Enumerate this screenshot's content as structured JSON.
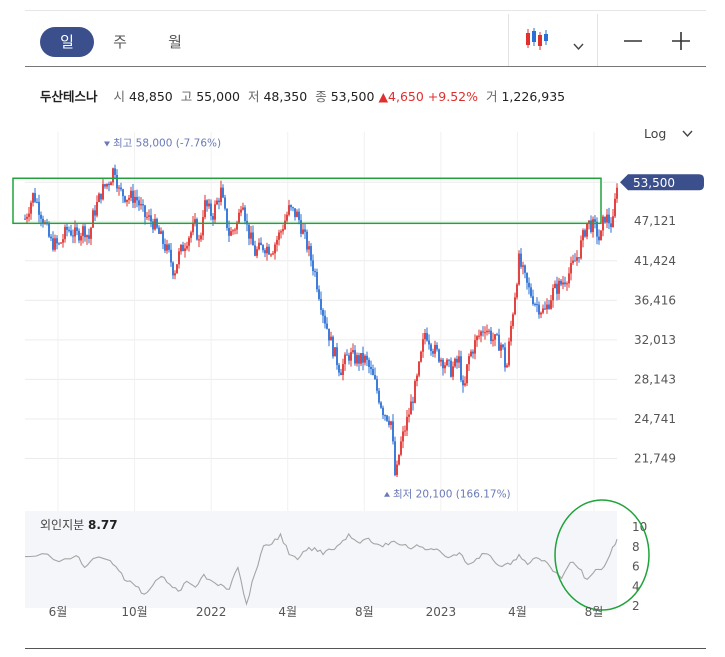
{
  "tabs": [
    {
      "label": "일",
      "active": true
    },
    {
      "label": "주",
      "active": false
    },
    {
      "label": "월",
      "active": false
    }
  ],
  "toolbar": {
    "chart_type_icon": "candlestick-icon",
    "zoom_out": "−",
    "zoom_in": "+"
  },
  "quote": {
    "name": "두산테스나",
    "open_label": "시",
    "open": "48,850",
    "high_label": "고",
    "high": "55,000",
    "low_label": "저",
    "low": "48,350",
    "close_label": "종",
    "close": "53,500",
    "change": "▲4,650 +9.52%",
    "volume_label": "거",
    "volume": "1,226,935"
  },
  "scale_toggle": "Log",
  "colors": {
    "up": "#e0302e",
    "down": "#2a6fd6",
    "accent": "#3a4f8c",
    "highlight": "#1fa33a",
    "indicator": "#a5a5a5"
  },
  "chart_data": {
    "type": "candlestick",
    "scale": "log",
    "ylim": [
      19500,
      61000
    ],
    "yticks": [
      "53,500",
      "47,121",
      "41,424",
      "36,416",
      "32,013",
      "28,143",
      "24,741",
      "21,749"
    ],
    "xticks": [
      "6월",
      "10월",
      "2022",
      "4월",
      "8월",
      "2023",
      "4월",
      "8월"
    ],
    "last_price": "53,500",
    "high_annotation": "최고 58,000 (-7.76%)",
    "low_annotation": "최저 20,100 (166.17%)",
    "series_path": [
      [
        0,
        47500
      ],
      [
        2,
        51500
      ],
      [
        4,
        48000
      ],
      [
        6,
        44000
      ],
      [
        8,
        43500
      ],
      [
        10,
        46000
      ],
      [
        12,
        45000
      ],
      [
        14,
        46000
      ],
      [
        15,
        44500
      ],
      [
        16,
        48000
      ],
      [
        18,
        52000
      ],
      [
        20,
        54000
      ],
      [
        21,
        56500
      ],
      [
        22,
        52000
      ],
      [
        24,
        51000
      ],
      [
        26,
        51000
      ],
      [
        28,
        48000
      ],
      [
        30,
        47000
      ],
      [
        32,
        44500
      ],
      [
        34,
        42000
      ],
      [
        35,
        39800
      ],
      [
        36,
        42000
      ],
      [
        38,
        44500
      ],
      [
        40,
        46500
      ],
      [
        41,
        43500
      ],
      [
        42,
        50000
      ],
      [
        44,
        48000
      ],
      [
        46,
        52000
      ],
      [
        47,
        48000
      ],
      [
        48,
        45000
      ],
      [
        50,
        47000
      ],
      [
        51,
        51500
      ],
      [
        52,
        46500
      ],
      [
        54,
        42500
      ],
      [
        56,
        43500
      ],
      [
        58,
        43000
      ],
      [
        60,
        45500
      ],
      [
        62,
        49000
      ],
      [
        64,
        48000
      ],
      [
        66,
        44000
      ],
      [
        68,
        40000
      ],
      [
        70,
        35000
      ],
      [
        72,
        31500
      ],
      [
        74,
        29000
      ],
      [
        76,
        30500
      ],
      [
        78,
        30000
      ],
      [
        80,
        30000
      ],
      [
        82,
        28000
      ],
      [
        84,
        25500
      ],
      [
        86,
        24500
      ],
      [
        87,
        20100
      ],
      [
        88,
        22500
      ],
      [
        90,
        25000
      ],
      [
        92,
        28000
      ],
      [
        94,
        33000
      ],
      [
        96,
        31000
      ],
      [
        98,
        30000
      ],
      [
        100,
        29000
      ],
      [
        102,
        30000
      ],
      [
        103,
        26500
      ],
      [
        104,
        30000
      ],
      [
        106,
        32000
      ],
      [
        108,
        33500
      ],
      [
        110,
        32000
      ],
      [
        112,
        31500
      ],
      [
        113,
        28800
      ],
      [
        114,
        33000
      ],
      [
        116,
        41500
      ],
      [
        118,
        38000
      ],
      [
        120,
        36000
      ],
      [
        122,
        35000
      ],
      [
        124,
        37500
      ],
      [
        126,
        38500
      ],
      [
        128,
        40000
      ],
      [
        130,
        42500
      ],
      [
        132,
        47000
      ],
      [
        134,
        46000
      ],
      [
        135,
        44000
      ],
      [
        136,
        48000
      ],
      [
        138,
        46500
      ],
      [
        139,
        53500
      ]
    ],
    "highlight_box": {
      "from_price": 46800,
      "to_price": 54200
    }
  },
  "indicator": {
    "label": "외인지분",
    "value": "8.77",
    "yticks": [
      "10",
      "8",
      "6",
      "4",
      "2"
    ],
    "ylim": [
      2,
      10
    ],
    "series_path": [
      [
        0,
        7.0
      ],
      [
        4,
        7.3
      ],
      [
        8,
        6.5
      ],
      [
        12,
        7.1
      ],
      [
        14,
        5.9
      ],
      [
        16,
        6.8
      ],
      [
        20,
        6.6
      ],
      [
        22,
        5.6
      ],
      [
        24,
        4.5
      ],
      [
        26,
        4.0
      ],
      [
        28,
        3.2
      ],
      [
        30,
        4.1
      ],
      [
        32,
        5.0
      ],
      [
        34,
        4.2
      ],
      [
        36,
        3.5
      ],
      [
        38,
        4.5
      ],
      [
        40,
        3.9
      ],
      [
        42,
        5.2
      ],
      [
        44,
        4.5
      ],
      [
        46,
        4.2
      ],
      [
        48,
        3.7
      ],
      [
        50,
        5.9
      ],
      [
        52,
        2.2
      ],
      [
        54,
        5.3
      ],
      [
        56,
        8.1
      ],
      [
        58,
        8.3
      ],
      [
        60,
        9.3
      ],
      [
        62,
        7.2
      ],
      [
        64,
        6.7
      ],
      [
        66,
        7.6
      ],
      [
        68,
        7.9
      ],
      [
        70,
        7.2
      ],
      [
        72,
        7.7
      ],
      [
        74,
        8.3
      ],
      [
        76,
        9.3
      ],
      [
        78,
        8.5
      ],
      [
        80,
        8.8
      ],
      [
        82,
        8.3
      ],
      [
        84,
        8.0
      ],
      [
        86,
        8.5
      ],
      [
        88,
        8.2
      ],
      [
        90,
        7.9
      ],
      [
        92,
        8.2
      ],
      [
        94,
        7.7
      ],
      [
        96,
        7.7
      ],
      [
        98,
        7.3
      ],
      [
        100,
        7.0
      ],
      [
        102,
        7.4
      ],
      [
        104,
        6.2
      ],
      [
        106,
        6.8
      ],
      [
        108,
        7.3
      ],
      [
        110,
        6.6
      ],
      [
        112,
        6.0
      ],
      [
        114,
        6.2
      ],
      [
        116,
        7.2
      ],
      [
        118,
        6.2
      ],
      [
        120,
        6.9
      ],
      [
        122,
        6.6
      ],
      [
        124,
        5.5
      ],
      [
        126,
        4.8
      ],
      [
        128,
        6.4
      ],
      [
        130,
        5.8
      ],
      [
        132,
        4.7
      ],
      [
        134,
        5.7
      ],
      [
        136,
        6.0
      ],
      [
        138,
        8.0
      ],
      [
        139,
        8.77
      ]
    ]
  }
}
